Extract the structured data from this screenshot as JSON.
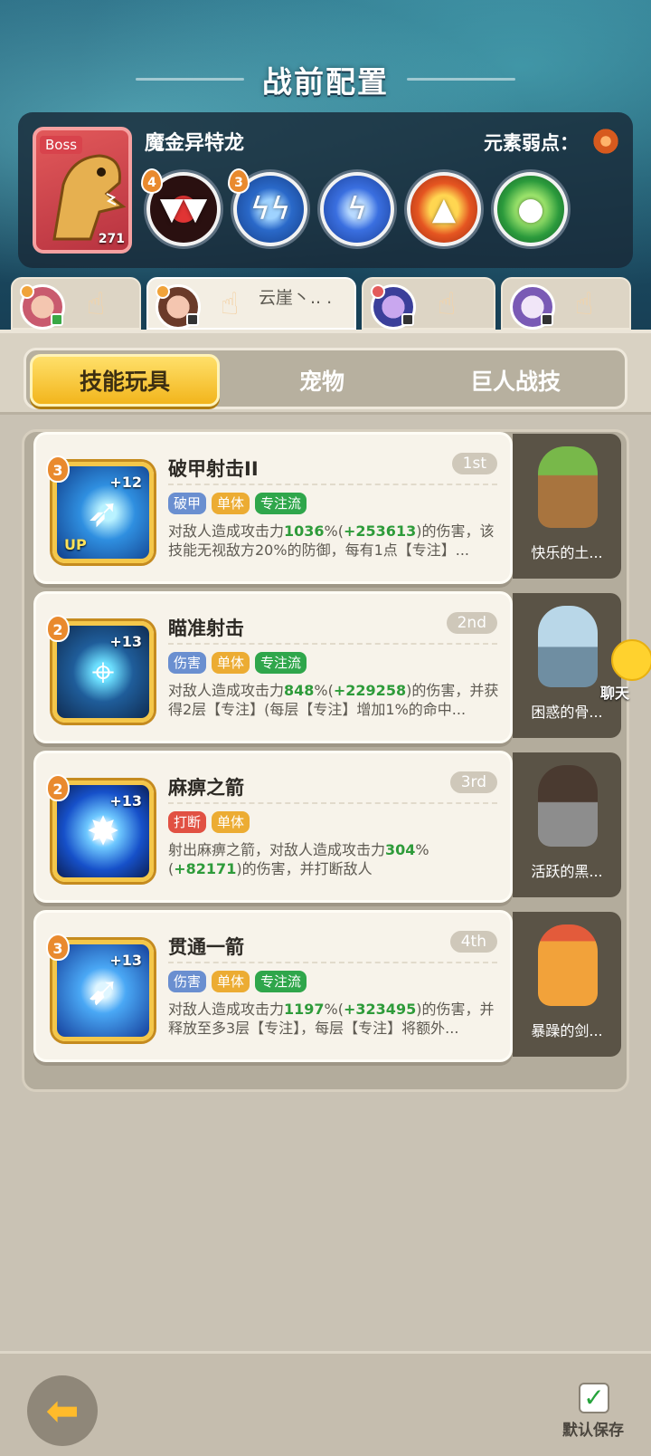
{
  "header": {
    "title": "战前配置"
  },
  "boss": {
    "tag": "Boss",
    "level": "271",
    "name": "魔金异特龙",
    "weakness_label": "元素弱点：",
    "skills": [
      {
        "icon": "fanged-mouth-icon",
        "badge": "4"
      },
      {
        "icon": "lightning-claw-icon",
        "badge": "3"
      },
      {
        "icon": "lightning-bolt-icon",
        "badge": ""
      },
      {
        "icon": "golden-spike-icon",
        "badge": ""
      },
      {
        "icon": "green-slime-icon",
        "badge": ""
      }
    ]
  },
  "characters": [
    {
      "name": ""
    },
    {
      "name": "云崖丶.. ."
    },
    {
      "name": ""
    },
    {
      "name": ""
    }
  ],
  "tabs": {
    "skills": "技能玩具",
    "pets": "宠物",
    "giant": "巨人战技"
  },
  "cards": [
    {
      "title": "破甲射击II",
      "rank": "1st",
      "level": "3",
      "plus": "+12",
      "up": "UP",
      "tags": [
        "破甲",
        "单体",
        "专注流"
      ],
      "d1": "对敌人造成攻击力",
      "v1": "1036",
      "d2": "%(",
      "v2": "+253613",
      "d3": ")的伤害，该技能无视敌方20%的防御，每有1点【专注】...",
      "pet": "快乐的土..."
    },
    {
      "title": "瞄准射击",
      "rank": "2nd",
      "level": "2",
      "plus": "+13",
      "tags": [
        "伤害",
        "单体",
        "专注流"
      ],
      "d1": "对敌人造成攻击力",
      "v1": "848",
      "d2": "%(",
      "v2": "+229258",
      "d3": ")的伤害，并获得2层【专注】(每层【专注】增加1%的命中...",
      "pet": "困惑的骨..."
    },
    {
      "title": "麻痹之箭",
      "rank": "3rd",
      "level": "2",
      "plus": "+13",
      "tags": [
        "打断",
        "单体"
      ],
      "d1": "射出麻痹之箭，对敌人造成攻击力",
      "v1": "304",
      "d2": "%(",
      "v2": "+82171",
      "d3": ")的伤害，并打断敌人",
      "pet": "活跃的黑..."
    },
    {
      "title": "贯通一箭",
      "rank": "4th",
      "level": "3",
      "plus": "+13",
      "tags": [
        "伤害",
        "单体",
        "专注流"
      ],
      "d1": "对敌人造成攻击力",
      "v1": "1197",
      "d2": "%(",
      "v2": "+323495",
      "d3": ")的伤害，并释放至多3层【专注】，每层【专注】将额外...",
      "pet": "暴躁的剑..."
    }
  ],
  "chat": {
    "label": "聊天"
  },
  "footer": {
    "save_label": "默认保存"
  }
}
